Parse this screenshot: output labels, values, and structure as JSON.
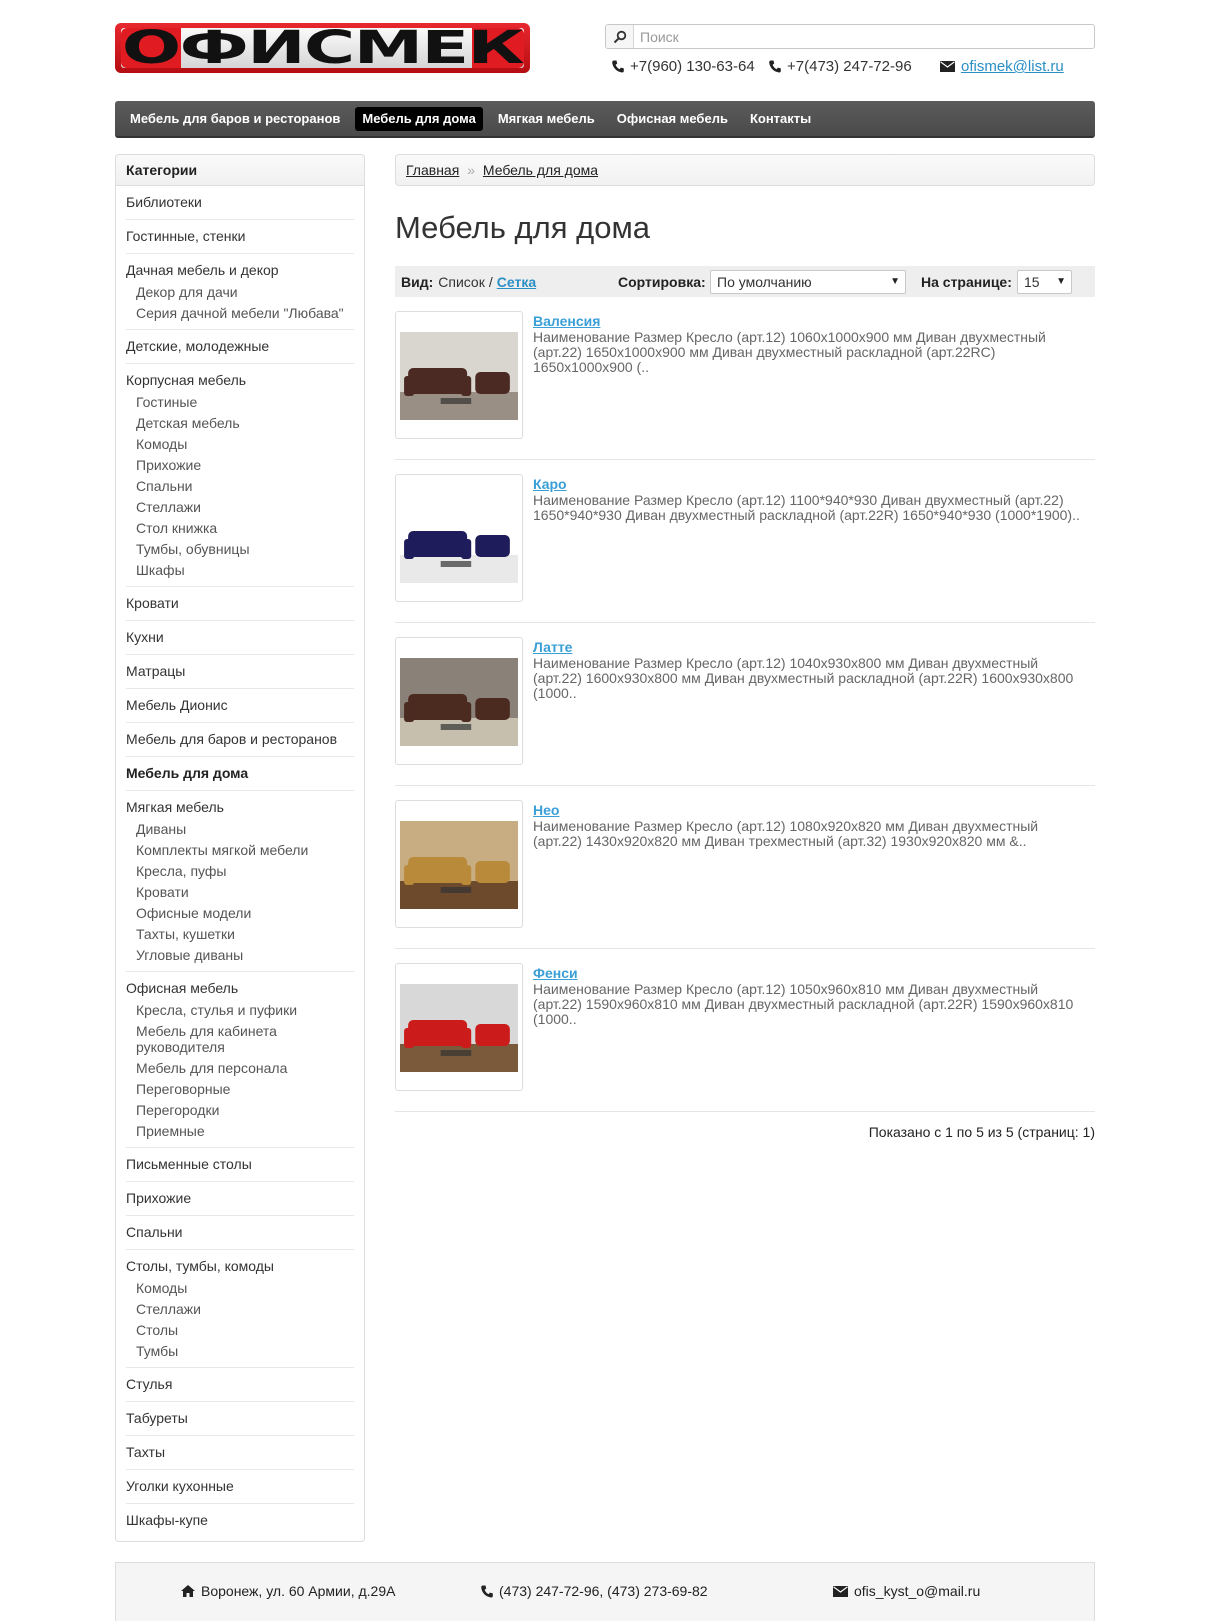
{
  "header": {
    "logo_text": "ОФИСМЕК",
    "search_placeholder": "Поиск",
    "phone1": "+7(960) 130-63-64",
    "phone2": "+7(473) 247-72-96",
    "email": "ofismek@list.ru"
  },
  "nav": [
    {
      "label": "Мебель для баров и ресторанов",
      "active": false
    },
    {
      "label": "Мебель для дома",
      "active": true
    },
    {
      "label": "Мягкая мебель",
      "active": false
    },
    {
      "label": "Офисная мебель",
      "active": false
    },
    {
      "label": "Контакты",
      "active": false
    }
  ],
  "sidebar": {
    "title": "Категории",
    "categories": [
      {
        "label": "Библиотеки",
        "subs": []
      },
      {
        "label": "Гостинные, стенки",
        "subs": []
      },
      {
        "label": "Дачная мебель и декор",
        "subs": [
          "Декор для дачи",
          "Серия дачной мебели \"Любава\""
        ]
      },
      {
        "label": "Детские, молодежные",
        "subs": []
      },
      {
        "label": "Корпусная мебель",
        "subs": [
          "Гостиные",
          "Детская мебель",
          "Комоды",
          "Прихожие",
          "Спальни",
          "Стеллажи",
          "Стол книжка",
          "Тумбы, обувницы",
          "Шкафы"
        ]
      },
      {
        "label": "Кровати",
        "subs": []
      },
      {
        "label": "Кухни",
        "subs": []
      },
      {
        "label": "Матрацы",
        "subs": []
      },
      {
        "label": "Мебель Дионис",
        "subs": []
      },
      {
        "label": "Мебель для баров и ресторанов",
        "subs": []
      },
      {
        "label": "Мебель для дома",
        "subs": [],
        "bold": true
      },
      {
        "label": "Мягкая мебель",
        "subs": [
          "Диваны",
          "Комплекты мягкой мебели",
          "Кресла, пуфы",
          "Кровати",
          "Офисные модели",
          "Тахты, кушетки",
          "Угловые диваны"
        ]
      },
      {
        "label": "Офисная мебель",
        "subs": [
          "Кресла, стулья и пуфики",
          "Мебель для кабинета руководителя",
          "Мебель для персонала",
          "Переговорные",
          "Перегородки",
          "Приемные"
        ]
      },
      {
        "label": "Письменные столы",
        "subs": []
      },
      {
        "label": "Прихожие",
        "subs": []
      },
      {
        "label": "Спальни",
        "subs": []
      },
      {
        "label": "Столы, тумбы, комоды",
        "subs": [
          "Комоды",
          "Стеллажи",
          "Столы",
          "Тумбы"
        ]
      },
      {
        "label": "Стулья",
        "subs": []
      },
      {
        "label": "Табуреты",
        "subs": []
      },
      {
        "label": "Тахты",
        "subs": []
      },
      {
        "label": "Уголки кухонные",
        "subs": []
      },
      {
        "label": "Шкафы-купе",
        "subs": []
      }
    ]
  },
  "breadcrumb": {
    "home": "Главная",
    "sep": "»",
    "current": "Мебель для дома"
  },
  "page_title": "Мебель для дома",
  "toolbar": {
    "view_label": "Вид:",
    "view_list": "Список",
    "view_sep": "/",
    "view_grid": "Сетка",
    "sort_label": "Сортировка:",
    "sort_value": "По умолчанию",
    "per_page_label": "На странице:",
    "per_page_value": "15"
  },
  "products": [
    {
      "name": "Валенсия",
      "desc": "Наименование Размер Кресло (арт.12) 1060x1000x900 мм Диван двухместный (арт.22) 1650x1000x900 мм Диван двухместный раскладной (арт.22RC) 1650x1000x900 (..",
      "palette": {
        "bg": "#d9d6d0",
        "sofa": "#4a2a22",
        "floor": "#9a8f84"
      }
    },
    {
      "name": "Каро",
      "desc": "Наименование Размер Кресло (арт.12) 1100*940*930 Диван двухместный (арт.22) 1650*940*930 Диван двухместный раскладной (арт.22R) 1650*940*930 (1000*1900)..",
      "palette": {
        "bg": "#ffffff",
        "sofa": "#1e1c5a",
        "floor": "#e9e9e9"
      }
    },
    {
      "name": "Латте",
      "desc": "Наименование Размер Кресло (арт.12) 1040x930x800 мм Диван двухместный (арт.22) 1600x930x800 мм Диван двухместный раскладной (арт.22R) 1600x930x800 (1000..",
      "palette": {
        "bg": "#8a8178",
        "sofa": "#4b2a20",
        "floor": "#c7bfae"
      }
    },
    {
      "name": "Нео",
      "desc": "Наименование Размер Кресло (арт.12) 1080x920x820 мм Диван двухместный (арт.22) 1430x920x820 мм Диван трехместный (арт.32) 1930x920x820 мм &..",
      "palette": {
        "bg": "#c9ad82",
        "sofa": "#b98a3a",
        "floor": "#6e4a2c"
      }
    },
    {
      "name": "Фенси",
      "desc": "Наименование Размер Кресло (арт.12) 1050x960x810 мм Диван двухместный (арт.22) 1590x960x810 мм Диван двухместный раскладной (арт.22R) 1590x960x810 (1000..",
      "palette": {
        "bg": "#d8d8d8",
        "sofa": "#cc1b1b",
        "floor": "#7a5a3a"
      }
    }
  ],
  "pager": "Показано с 1 по 5 из 5 (страниц: 1)",
  "footer": {
    "address": "Воронеж, ул. 60 Армии, д.29А",
    "phones": "(473) 247-72-96, (473) 273-69-82",
    "email": "ofis_kyst_o@mail.ru"
  }
}
